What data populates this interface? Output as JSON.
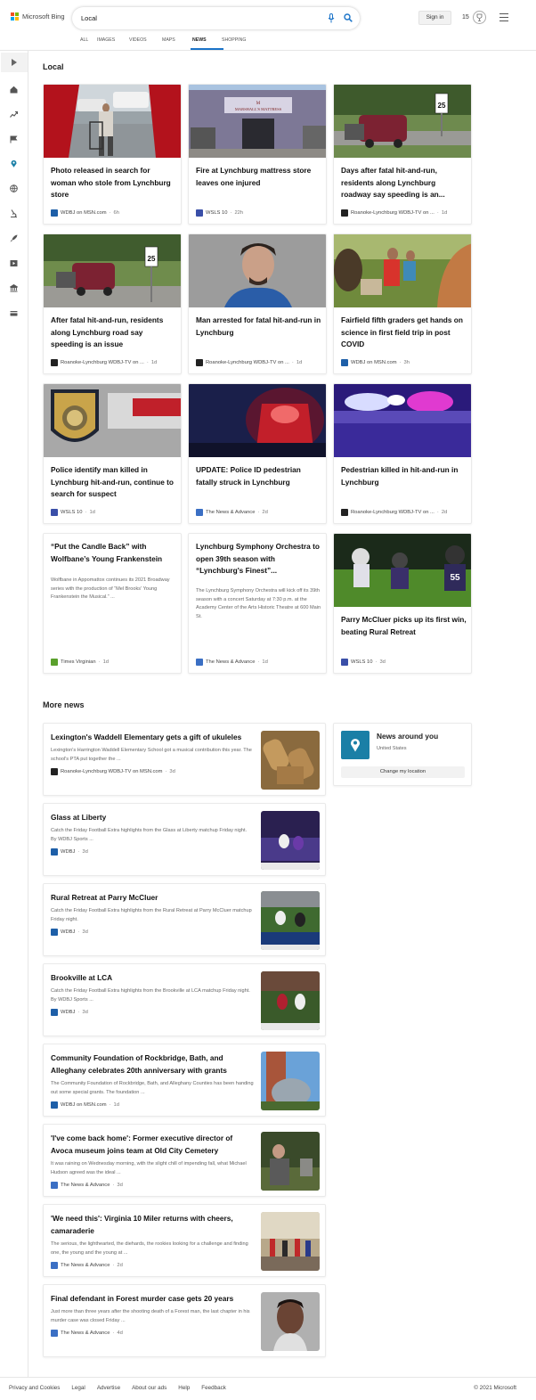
{
  "header": {
    "brand": "Microsoft Bing",
    "search_query": "Local",
    "sign_in": "Sign in",
    "points": "15",
    "tabs": [
      "ALL",
      "IMAGES",
      "VIDEOS",
      "MAPS",
      "NEWS",
      "SHOPPING"
    ],
    "active_tab": "NEWS"
  },
  "colors": {
    "accent": "#1a73c8",
    "location_tile": "#1a7fa6"
  },
  "rail": {
    "icons": [
      "expand-icon",
      "home-icon",
      "trending-icon",
      "flag-icon",
      "location-pin-icon",
      "globe-icon",
      "science-icon",
      "rocket-icon",
      "video-icon",
      "politics-icon",
      "money-icon"
    ]
  },
  "local": {
    "heading": "Local",
    "cards": [
      {
        "title": "Photo released in search for woman who stole from Lynchburg store",
        "source": "WDBJ on MSN.com",
        "time": "6h",
        "image": "woman-parking-lot-photo"
      },
      {
        "title": "Fire at Lynchburg mattress store leaves one injured",
        "source": "WSLS 10",
        "time": "22h",
        "image": "mattress-store-photo"
      },
      {
        "title": "Days after fatal hit-and-run, residents along Lynchburg roadway say speeding is an...",
        "source": "Roanoke-Lynchburg WDBJ-TV on ...",
        "time": "1d",
        "image": "roadway-speed-sign-photo"
      },
      {
        "title": "After fatal hit-and-run, residents along Lynchburg road say speeding is an issue",
        "source": "Roanoke-Lynchburg WDBJ-TV on ...",
        "time": "1d",
        "image": "road-truck-photo"
      },
      {
        "title": "Man arrested for fatal hit-and-run in Lynchburg",
        "source": "Roanoke-Lynchburg WDBJ-TV on ...",
        "time": "1d",
        "image": "mugshot-photo"
      },
      {
        "title": "Fairfield fifth graders get hands on science in first field trip in post COVID",
        "source": "WDBJ on MSN.com",
        "time": "3h",
        "image": "field-trip-photo"
      },
      {
        "title": "Police identify man killed in Lynchburg hit-and-run, continue to search for suspect",
        "source": "WSLS 10",
        "time": "1d",
        "image": "police-patch-photo"
      },
      {
        "title": "UPDATE: Police ID pedestrian fatally struck in Lynchburg",
        "source": "The News & Advance",
        "time": "2d",
        "image": "red-siren-photo"
      },
      {
        "title": "Pedestrian killed in hit-and-run in Lynchburg",
        "source": "Roanoke-Lynchburg WDBJ-TV on ...",
        "time": "2d",
        "image": "police-lights-photo"
      },
      {
        "title": "“Put the Candle Back” with Wolfbane’s Young Frankenstein",
        "snippet": "Wolfbane in Appomattox continues its 2021 Broadway series with the production of “Mel Brooks' Young Frankenstein the Musical.” ...",
        "source": "Times Virginian",
        "time": "1d"
      },
      {
        "title": "Lynchburg Symphony Orchestra to open 39th season with “Lynchburg's Finest”...",
        "snippet": "The Lynchburg Symphony Orchestra will kick off its 39th season with a concert Saturday at 7:30 p.m. at the Academy Center of the Arts Historic Theatre at 600 Main St.",
        "source": "The News & Advance",
        "time": "1d"
      },
      {
        "title": "Parry McCluer picks up its first win, beating Rural Retreat",
        "source": "WSLS 10",
        "time": "3d",
        "image": "football-photo"
      }
    ]
  },
  "more_news": {
    "heading": "More news",
    "items": [
      {
        "title": "Lexington's Waddell Elementary gets a gift of ukuleles",
        "snippet": "Lexington's Harrington Waddell Elementary School got a musical contribution this year. The school's PTA put together the ...",
        "source": "Roanoke-Lynchburg WDBJ-TV on MSN.com",
        "time": "3d"
      },
      {
        "title": "Glass at Liberty",
        "snippet": "Catch the Friday Football Extra highlights from the Glass at Liberty matchup Friday night. By WDBJ Sports ...",
        "source": "WDBJ",
        "time": "3d"
      },
      {
        "title": "Rural Retreat at Parry McCluer",
        "snippet": "Catch the Friday Football Extra highlights from the Rural Retreat at Parry McCluer matchup Friday night.",
        "source": "WDBJ",
        "time": "3d"
      },
      {
        "title": "Brookville at LCA",
        "snippet": "Catch the Friday Football Extra highlights from the Brookville at LCA matchup Friday night. By WDBJ Sports ...",
        "source": "WDBJ",
        "time": "3d"
      },
      {
        "title": "Community Foundation of Rockbridge, Bath, and Alleghany celebrates 20th anniversary with grants",
        "snippet": "The Community Foundation of Rockbridge, Bath, and Alleghany Counties has been handing out some special grants. The foundation ...",
        "source": "WDBJ on MSN.com",
        "time": "1d"
      },
      {
        "title": "'I've come back home': Former executive director of Avoca museum joins team at Old City Cemetery",
        "snippet": "It was raining on Wednesday morning, with the slight chill of impending fall, what Michael Hudson agreed was the ideal ...",
        "source": "The News & Advance",
        "time": "3d"
      },
      {
        "title": "'We need this': Virginia 10 Miler returns with cheers, camaraderie",
        "snippet": "The serious, the lighthearted, the diehards, the rookies looking for a challenge and finding one, the young and the young at ...",
        "source": "The News & Advance",
        "time": "2d"
      },
      {
        "title": "Final defendant in Forest murder case gets 20 years",
        "snippet": "Just more than three years after the shooting death of a Forest man, the last chapter in his murder case was closed Friday ...",
        "source": "The News & Advance",
        "time": "4d"
      }
    ]
  },
  "around": {
    "title": "News around you",
    "location": "United States",
    "button": "Change my location"
  },
  "footer": {
    "links": [
      "Privacy and Cookies",
      "Legal",
      "Advertise",
      "About our ads",
      "Help",
      "Feedback"
    ],
    "copyright": "© 2021 Microsoft"
  }
}
